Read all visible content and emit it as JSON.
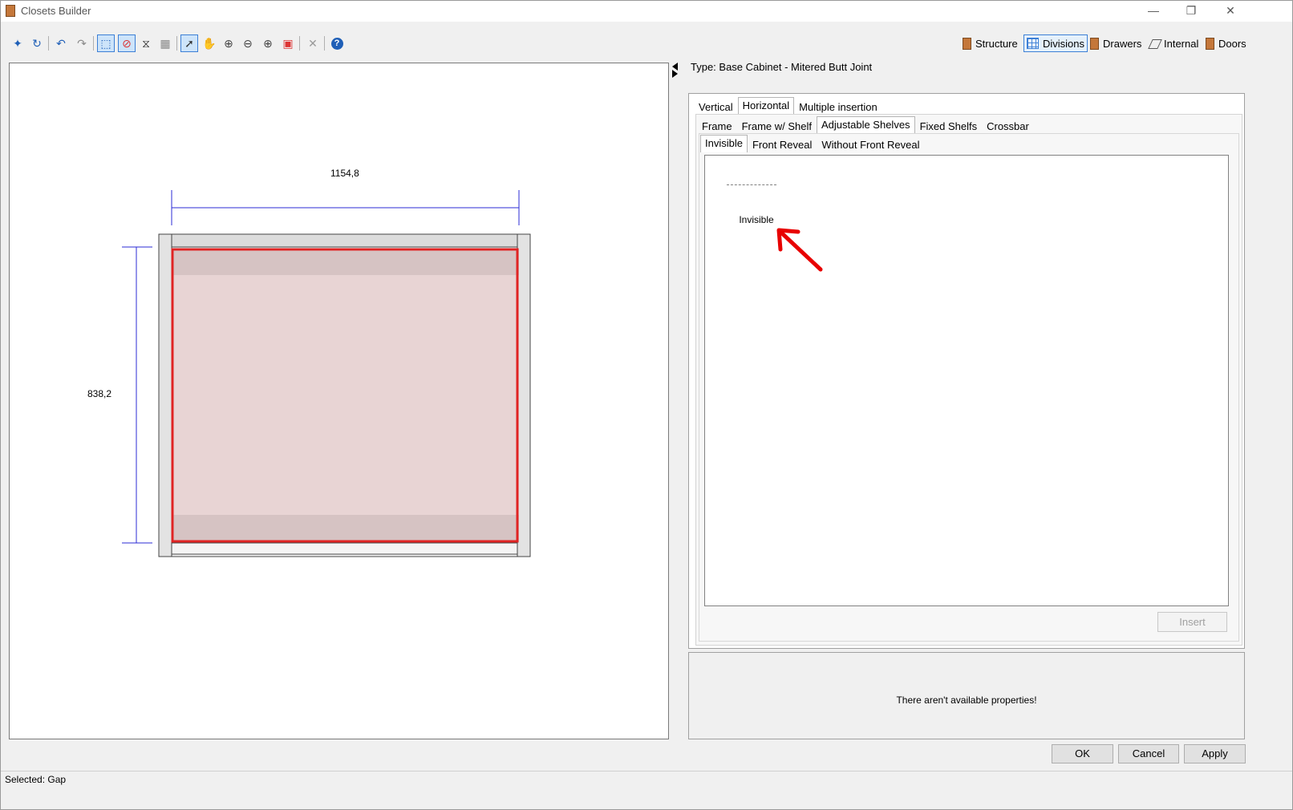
{
  "window": {
    "title": "Closets Builder",
    "minimize": "—",
    "restore": "❐",
    "close": "✕"
  },
  "toolbar": {
    "tools": [
      {
        "name": "new-icon",
        "glyph": "✦"
      },
      {
        "name": "refresh-icon",
        "glyph": "↻"
      },
      {
        "name": "undo-icon",
        "glyph": "↶"
      },
      {
        "name": "redo-icon",
        "glyph": "↷"
      },
      {
        "name": "select-division-icon",
        "glyph": "⬚"
      },
      {
        "name": "remove-division-icon",
        "glyph": "⊘"
      },
      {
        "name": "measure-icon",
        "glyph": "⧖"
      },
      {
        "name": "grid-icon",
        "glyph": "▦"
      },
      {
        "name": "pointer-icon",
        "glyph": "➚"
      },
      {
        "name": "pan-icon",
        "glyph": "✋"
      },
      {
        "name": "zoom-fit-icon",
        "glyph": "⊕"
      },
      {
        "name": "zoom-out-icon",
        "glyph": "⊖"
      },
      {
        "name": "zoom-in-icon",
        "glyph": "⊕"
      },
      {
        "name": "view-icon",
        "glyph": "▣"
      },
      {
        "name": "delete-icon",
        "glyph": "✕"
      },
      {
        "name": "help-icon",
        "glyph": "?"
      }
    ],
    "modes": {
      "structure": "Structure",
      "divisions": "Divisions",
      "drawers": "Drawers",
      "internal": "Internal",
      "doors": "Doors"
    }
  },
  "canvas": {
    "width_dimension": "1154,8",
    "height_dimension": "838,2"
  },
  "panel": {
    "type_label": "Type: Base Cabinet - Mitered Butt Joint",
    "tabs_level1": [
      "Vertical",
      "Horizontal",
      "Multiple insertion"
    ],
    "tabs_level2": [
      "Frame",
      "Frame w/ Shelf",
      "Adjustable Shelves",
      "Fixed Shelfs",
      "Crossbar"
    ],
    "tabs_level3": [
      "Invisible",
      "Front Reveal",
      "Without Front Reveal"
    ],
    "list_items": [
      {
        "label": "Invisible"
      }
    ],
    "insert_label": "Insert",
    "properties_message": "There aren't available properties!"
  },
  "buttons": {
    "ok": "OK",
    "cancel": "Cancel",
    "apply": "Apply"
  },
  "status": {
    "text": "Selected: Gap"
  },
  "colors": {
    "accent": "#3c7fd6",
    "dimension_line": "#2b2bd6",
    "selection": "#e02424",
    "gap_fill": "#e8d4d4"
  }
}
